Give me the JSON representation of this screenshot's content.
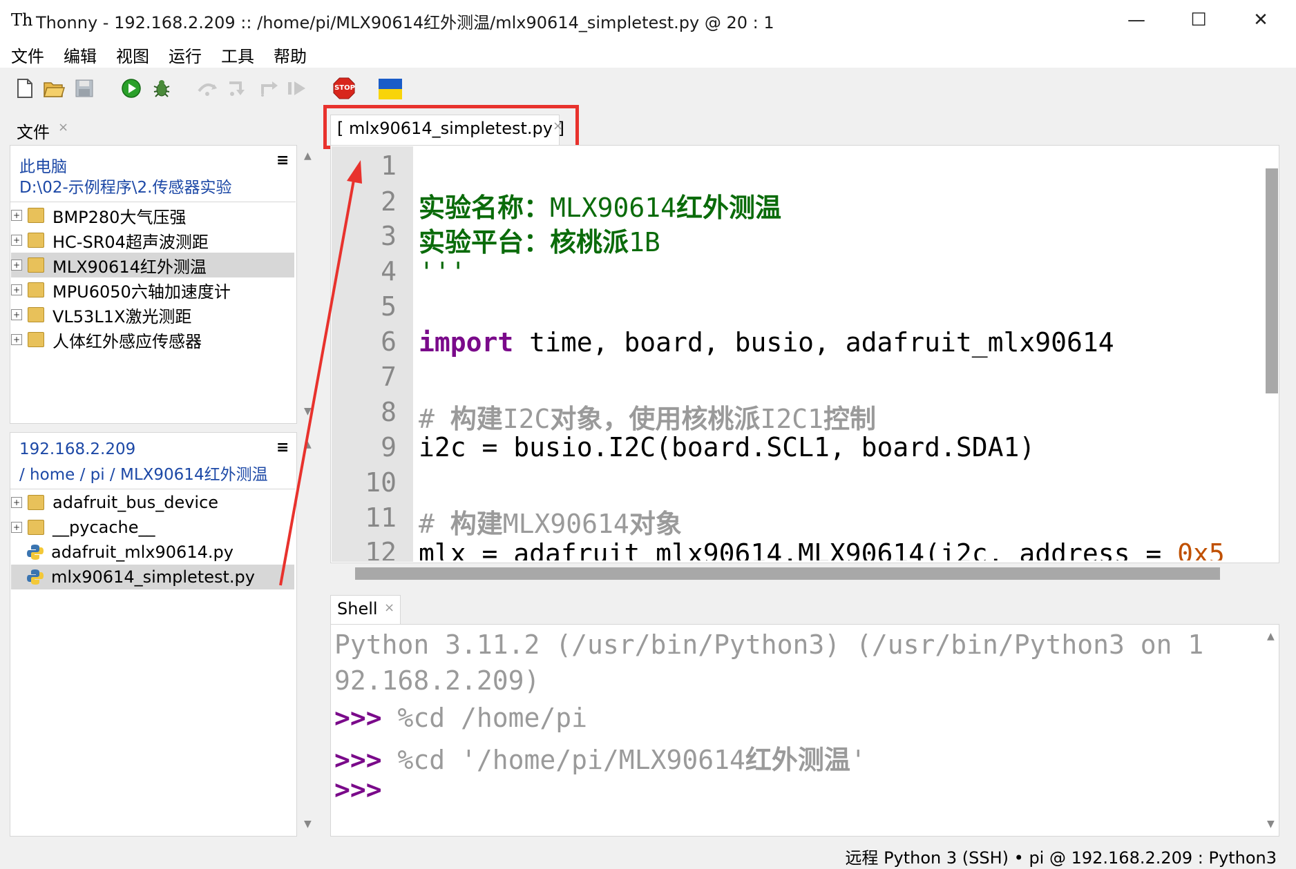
{
  "window": {
    "title": "Thonny  -  192.168.2.209 :: /home/pi/MLX90614红外测温/mlx90614_simpletest.py  @  20 : 1",
    "app_icon": "Th",
    "controls": {
      "minimize": "—",
      "maximize": "☐",
      "close": "✕"
    }
  },
  "menu": [
    "文件",
    "编辑",
    "视图",
    "运行",
    "工具",
    "帮助"
  ],
  "toolbar": {
    "icons": [
      "new-file-icon",
      "open-file-icon",
      "save-icon",
      "run-icon",
      "debug-icon",
      "step-over-icon",
      "step-into-icon",
      "step-out-icon",
      "resume-icon",
      "stop-icon",
      "ukraine-flag-icon"
    ],
    "stop_label": "STOP"
  },
  "files_panel": {
    "tab_label": "文件",
    "local": {
      "title": "此电脑",
      "path": "D:\\02-示例程序\\2.传感器实验",
      "items": [
        {
          "label": "BMP280大气压强",
          "type": "folder",
          "selected": false
        },
        {
          "label": "HC-SR04超声波测距",
          "type": "folder",
          "selected": false
        },
        {
          "label": "MLX90614红外测温",
          "type": "folder",
          "selected": true
        },
        {
          "label": "MPU6050六轴加速度计",
          "type": "folder",
          "selected": false
        },
        {
          "label": "VL53L1X激光测距",
          "type": "folder",
          "selected": false
        },
        {
          "label": "人体红外感应传感器",
          "type": "folder",
          "selected": false
        }
      ]
    },
    "remote": {
      "title": "192.168.2.209",
      "path": "/ home / pi / MLX90614红外测温",
      "items": [
        {
          "label": "adafruit_bus_device",
          "type": "folder",
          "selected": false
        },
        {
          "label": "__pycache__",
          "type": "folder",
          "selected": false
        },
        {
          "label": "adafruit_mlx90614.py",
          "type": "python",
          "selected": false
        },
        {
          "label": "mlx90614_simpletest.py",
          "type": "python",
          "selected": true
        }
      ]
    },
    "menu_glyph": "≡"
  },
  "editor": {
    "tab_label": "[ mlx90614_simpletest.py ]",
    "line_numbers": [
      "1",
      "2",
      "3",
      "4",
      "5",
      "6",
      "7",
      "8",
      "9",
      "10",
      "11",
      "12"
    ],
    "lines": {
      "l1": "'''",
      "l2a": "实验名称：",
      "l2b": "MLX90614",
      "l2c": "红外测温",
      "l3a": "实验平台：",
      "l3b": "核桃派",
      "l3c": "1B",
      "l4": "'''",
      "l6a": "import",
      "l6b": " time, board, busio, adafruit_mlx90614",
      "l8a": "# ",
      "l8b": "构建",
      "l8c": "I2C",
      "l8d": "对象，使用核桃派",
      "l8e": "I2C1",
      "l8f": "控制",
      "l9": "i2c = busio.I2C(board.SCL1, board.SDA1)",
      "l11a": "# ",
      "l11b": "构建",
      "l11c": "MLX90614",
      "l11d": "对象",
      "l12a": "mlx = adafruit_mlx90614.MLX90614(i2c, address = ",
      "l12b": "0x5"
    }
  },
  "shell": {
    "tab_label": "Shell",
    "line1": "Python 3.11.2 (/usr/bin/Python3) (/usr/bin/Python3 on 1",
    "line2": "92.168.2.209)",
    "prompt": ">>>",
    "cmd1": " %cd /home/pi",
    "cmd2a": " %cd '/home/pi/MLX90614",
    "cmd2b": "红外测温",
    "cmd2c": "'"
  },
  "status": "远程 Python 3 (SSH)  •  pi @ 192.168.2.209 : Python3",
  "colors": {
    "annotation_red": "#e8322d",
    "path_blue": "#1c48a6",
    "string_green": "#0a6b0a",
    "keyword_purple": "#7a0a8a"
  }
}
